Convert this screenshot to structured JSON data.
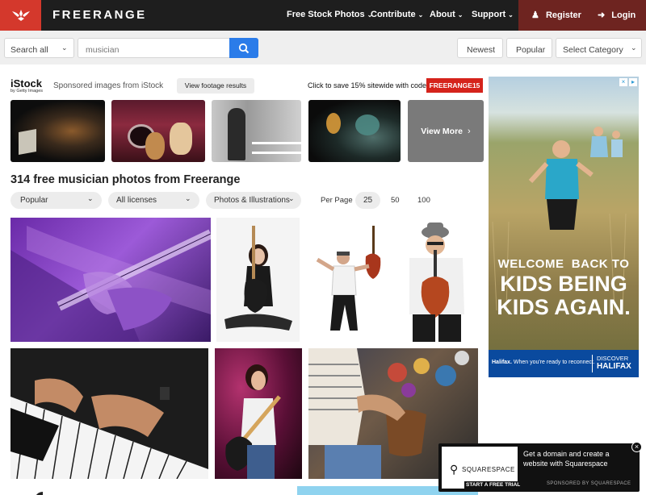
{
  "header": {
    "brand": "FREERANGE",
    "nav": [
      {
        "label": "Free Stock Photos"
      },
      {
        "label": "Contribute"
      },
      {
        "label": "About"
      },
      {
        "label": "Support"
      }
    ],
    "register_label": "Register",
    "login_label": "Login",
    "colors": {
      "bar": "#1e1e1e",
      "logo_bg": "#d4382c",
      "auth_bg": "#6e2420"
    }
  },
  "search": {
    "scope": "Search all",
    "query": "musician",
    "sort_newest": "Newest",
    "sort_popular": "Popular",
    "category": "Select Category"
  },
  "istock": {
    "logo": "iStock",
    "logo_sub": "by Getty Images",
    "sponsored_text": "Sponsored images from iStock",
    "footage_button": "View footage results",
    "promo_text": "Click to save 15% sitewide with code",
    "promo_code": "FREERANGE15",
    "view_more": "View More"
  },
  "results": {
    "heading": "314 free musician photos from Freerange",
    "filter_sort": "Popular",
    "filter_license": "All licenses",
    "filter_type": "Photos & Illustrations",
    "per_page_label": "Per Page",
    "per_page_options": [
      "25",
      "50",
      "100"
    ],
    "per_page_selected": "25"
  },
  "ad": {
    "headline_1": "WELCOME  BACK TO",
    "headline_2": "KIDS BEING",
    "headline_3": "KIDS AGAIN.",
    "bank": "Halifax.",
    "tagline": "When you're ready to reconnect.",
    "cta_1": "DISCOVER",
    "cta_2": "HALIFAX"
  },
  "popup": {
    "brand": "SQUARESPACE",
    "trial": "START A FREE TRIAL",
    "text": "Get a domain and create a website with Squarespace",
    "sponsor": "SPONSORED BY SQUARESPACE"
  }
}
